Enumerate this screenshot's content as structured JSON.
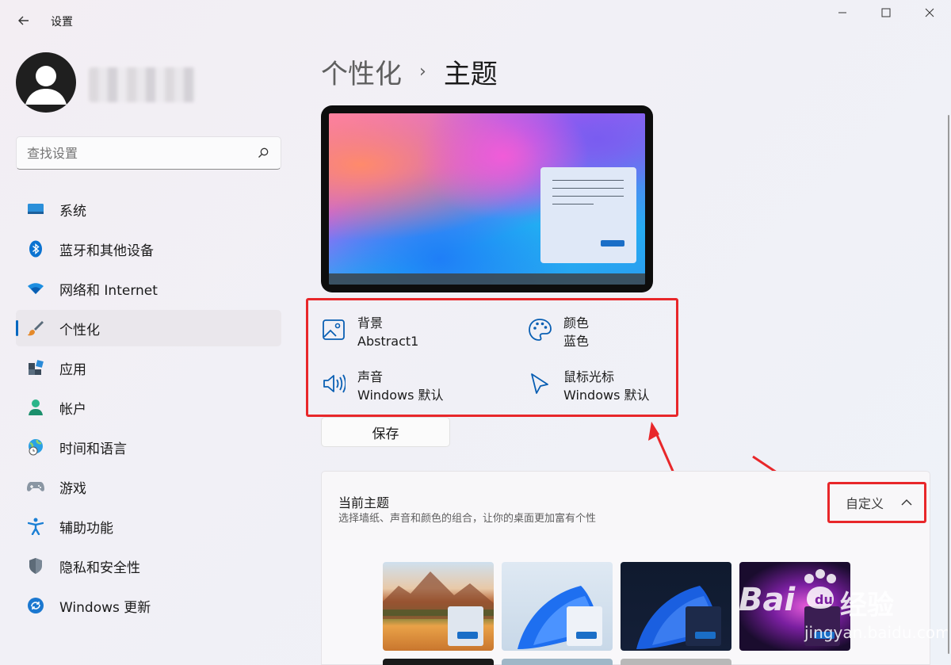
{
  "window": {
    "title": "设置",
    "controls": [
      "minimize-icon",
      "maximize-icon",
      "close-icon"
    ]
  },
  "profile": {
    "avatar": "user-avatar-icon",
    "name": ""
  },
  "search": {
    "placeholder": "查找设置",
    "icon": "search-icon"
  },
  "sidebar": {
    "items": [
      {
        "label": "系统",
        "icon": "system-icon",
        "active": false
      },
      {
        "label": "蓝牙和其他设备",
        "icon": "bluetooth-icon",
        "active": false
      },
      {
        "label": "网络和 Internet",
        "icon": "wifi-icon",
        "active": false
      },
      {
        "label": "个性化",
        "icon": "brush-icon",
        "active": true
      },
      {
        "label": "应用",
        "icon": "apps-icon",
        "active": false
      },
      {
        "label": "帐户",
        "icon": "account-icon",
        "active": false
      },
      {
        "label": "时间和语言",
        "icon": "globe-clock-icon",
        "active": false
      },
      {
        "label": "游戏",
        "icon": "gamepad-icon",
        "active": false
      },
      {
        "label": "辅助功能",
        "icon": "accessibility-icon",
        "active": false
      },
      {
        "label": "隐私和安全性",
        "icon": "shield-icon",
        "active": false
      },
      {
        "label": "Windows 更新",
        "icon": "update-icon",
        "active": false
      }
    ]
  },
  "breadcrumb": {
    "parent": "个性化",
    "separator": "›",
    "current": "主题"
  },
  "theme_properties": {
    "background": {
      "title": "背景",
      "value": "Abstract1",
      "icon": "image-icon"
    },
    "color": {
      "title": "颜色",
      "value": "蓝色",
      "icon": "palette-icon"
    },
    "sound": {
      "title": "声音",
      "value": "Windows 默认",
      "icon": "speaker-icon"
    },
    "cursor": {
      "title": "鼠标光标",
      "value": "Windows 默认",
      "icon": "cursor-icon"
    }
  },
  "save_label": "保存",
  "current_theme": {
    "title": "当前主题",
    "description": "选择墙纸、声音和颜色的组合，让你的桌面更加富有个性",
    "value": "自定义",
    "chevron": "chevron-up-icon"
  },
  "theme_thumbnails": [
    {
      "name": "mountain-lake-theme"
    },
    {
      "name": "windows-light-theme"
    },
    {
      "name": "windows-dark-theme"
    },
    {
      "name": "glow-theme"
    }
  ],
  "colors": {
    "accent": "#0067c0",
    "highlight_border": "#e8272a"
  },
  "watermark": {
    "brand": "Bai",
    "brand_cn": "经验",
    "url": "jingyan.baidu.com"
  }
}
